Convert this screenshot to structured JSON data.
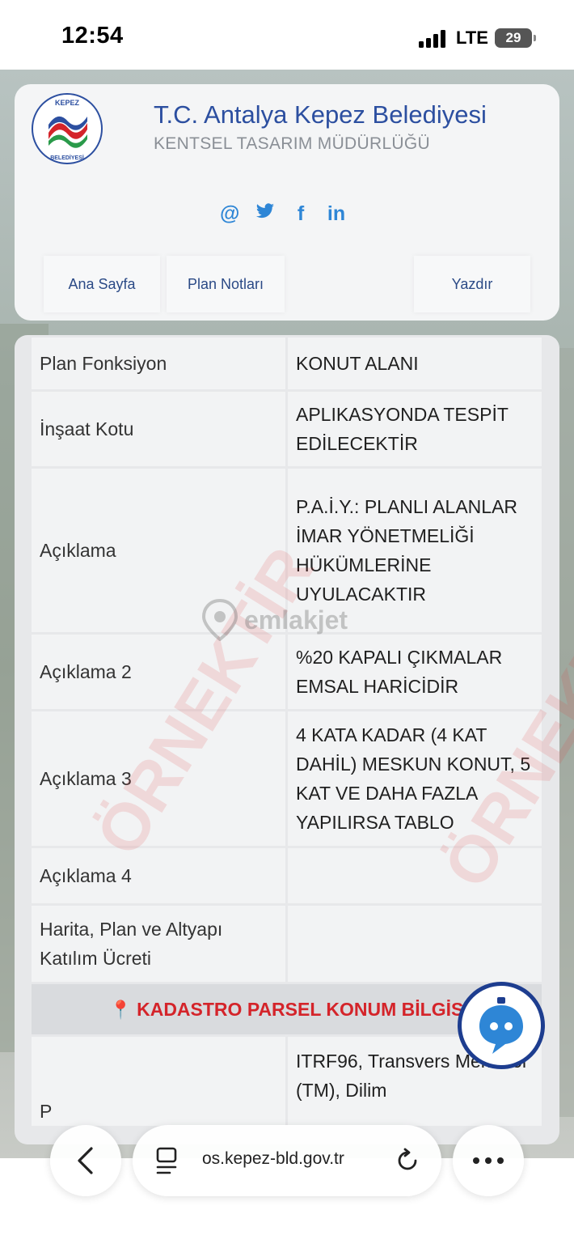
{
  "status_bar": {
    "time": "12:54",
    "network": "LTE",
    "battery": "29"
  },
  "header": {
    "logo_text": "KEPEZ BELEDİYESİ",
    "title": "T.C. Antalya Kepez Belediyesi",
    "subtitle": "KENTSEL TASARIM MÜDÜRLÜĞÜ",
    "social": {
      "email": "@",
      "twitter": "twitter-icon",
      "facebook": "f",
      "linkedin": "in"
    },
    "nav": {
      "home": "Ana Sayfa",
      "plan_notes": "Plan Notları",
      "print": "Yazdır"
    }
  },
  "table": {
    "rows": [
      {
        "key": "Plan Fonksiyon",
        "value": "KONUT ALANI"
      },
      {
        "key": "İnşaat Kotu",
        "value": "APLIKASYONDA TESPİT EDİLECEKTİR"
      },
      {
        "key": "Açıklama",
        "value": "P.A.İ.Y.: PLANLI ALANLAR İMAR YÖNETMELİĞİ HÜKÜMLERİNE UYULACAKTIR"
      },
      {
        "key": "Açıklama 2",
        "value": "%20 KAPALI ÇIKMALAR EMSAL HARİCİDİR"
      },
      {
        "key": "Açıklama 3",
        "value": "4 KATA KADAR (4 KAT DAHİL) MESKUN KONUT, 5 KAT VE DAHA FAZLA YAPILIRSA TABLO"
      },
      {
        "key": "Açıklama 4",
        "value": ""
      },
      {
        "key": "Harita, Plan ve Altyapı Katılım Ücreti",
        "value": ""
      }
    ],
    "section_title": "KADASTRO PARSEL KONUM BİLGİS",
    "projection_key": "P",
    "projection_value": "ITRF96, Transvers Merkator (TM), Dilim"
  },
  "watermark": {
    "brand": "emlakjet",
    "stamp": "ÖRNEKTİR"
  },
  "browser": {
    "url": "os.kepez-bld.gov.tr"
  }
}
